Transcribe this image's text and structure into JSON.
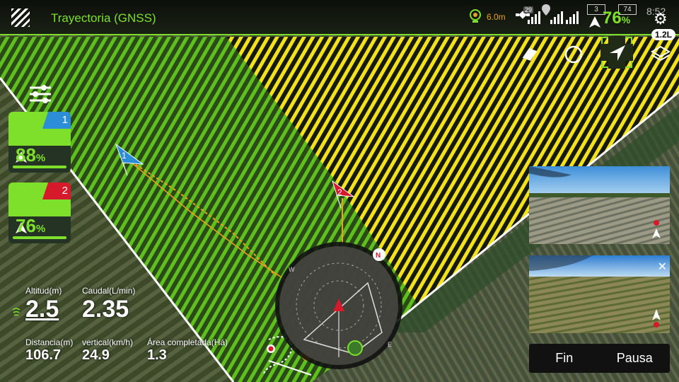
{
  "header": {
    "title": "Trayectoria (GNSS)",
    "rtk_value": "6.0m",
    "satellites": "29",
    "rc_battery": "3",
    "aircraft_battery": "74",
    "battery_percent": "76",
    "percent_symbol": "%",
    "clock": "8:52",
    "icons": [
      "app-logo-icon",
      "rtk-icon",
      "satellite-icon",
      "signal-icon",
      "battery-icon",
      "settings-icon"
    ]
  },
  "tools": {
    "tank_level": "1.2L",
    "icons": [
      "eraser-icon",
      "circle-icon",
      "locate-aircraft-icon",
      "layers-icon"
    ]
  },
  "drones": [
    {
      "id": "1",
      "battery": "88",
      "unit": "%",
      "color": "#2b8ed6"
    },
    {
      "id": "2",
      "battery": "76",
      "unit": "%",
      "color": "#d6192b"
    }
  ],
  "telemetry": {
    "altitude": {
      "label": "Altitud(m)",
      "value": "2.5"
    },
    "flow": {
      "label": "Caudal(L/min)",
      "value": "2.35"
    },
    "distance": {
      "label": "Distancia(m)",
      "value": "106.7"
    },
    "vertical": {
      "label": "vertical(km/h)",
      "value": "24.9"
    },
    "area": {
      "label": "Área completada(Há)",
      "value": "1.3"
    }
  },
  "map": {
    "drone_markers": [
      "1",
      "2"
    ],
    "compass_labels": {
      "west": "W",
      "east": "E"
    },
    "colors": {
      "field_sprayed": "#5fbf1f",
      "field_pending": "#f2e11b",
      "route": "#f0a020",
      "boundary": "#ffffff"
    }
  },
  "controls": {
    "finish": "Fin",
    "pause": "Pausa"
  }
}
